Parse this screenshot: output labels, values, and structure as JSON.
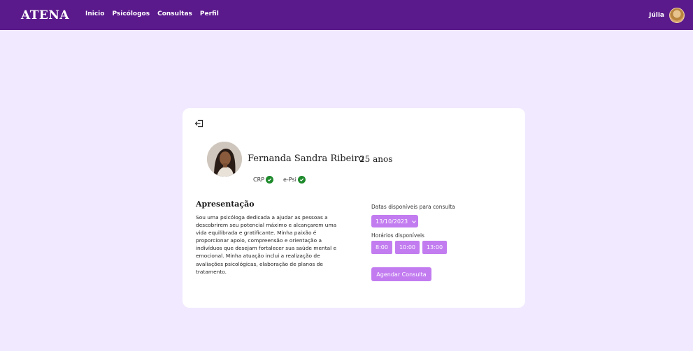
{
  "header": {
    "brand": "ATENA",
    "nav": [
      {
        "label": "Inicio"
      },
      {
        "label": "Psicólogos"
      },
      {
        "label": "Consultas"
      },
      {
        "label": "Perfil"
      }
    ],
    "user_name": "Júlia"
  },
  "profile": {
    "name": "Fernanda Sandra Ribeiro",
    "age": "25 anos",
    "badges": [
      {
        "label": "CRP"
      },
      {
        "label": "e-Psi"
      }
    ]
  },
  "about": {
    "title": "Apresentação",
    "text": "Sou uma psicóloga dedicada a ajudar as pessoas a descobrirem seu potencial máximo e alcançarem uma vida equilibrada e gratificante. Minha paixão é proporcionar apoio, compreensão e orientação a indivíduos que desejam fortalecer sua saúde mental e emocional. Minha atuação inclui a realização de avaliações psicológicas, elaboração de planos de tratamento."
  },
  "scheduling": {
    "dates_label": "Datas disponíveis para consulta",
    "selected_date": "13/10/2023",
    "times_label": "Horários disponíveis",
    "times": [
      "8:00",
      "10:00",
      "13:00"
    ],
    "schedule_button": "Agendar Consulta"
  },
  "colors": {
    "header_bg": "#5b1a8c",
    "page_bg": "#f1e9ff",
    "accent": "#c27cf0",
    "verified": "#1e8a2c"
  }
}
